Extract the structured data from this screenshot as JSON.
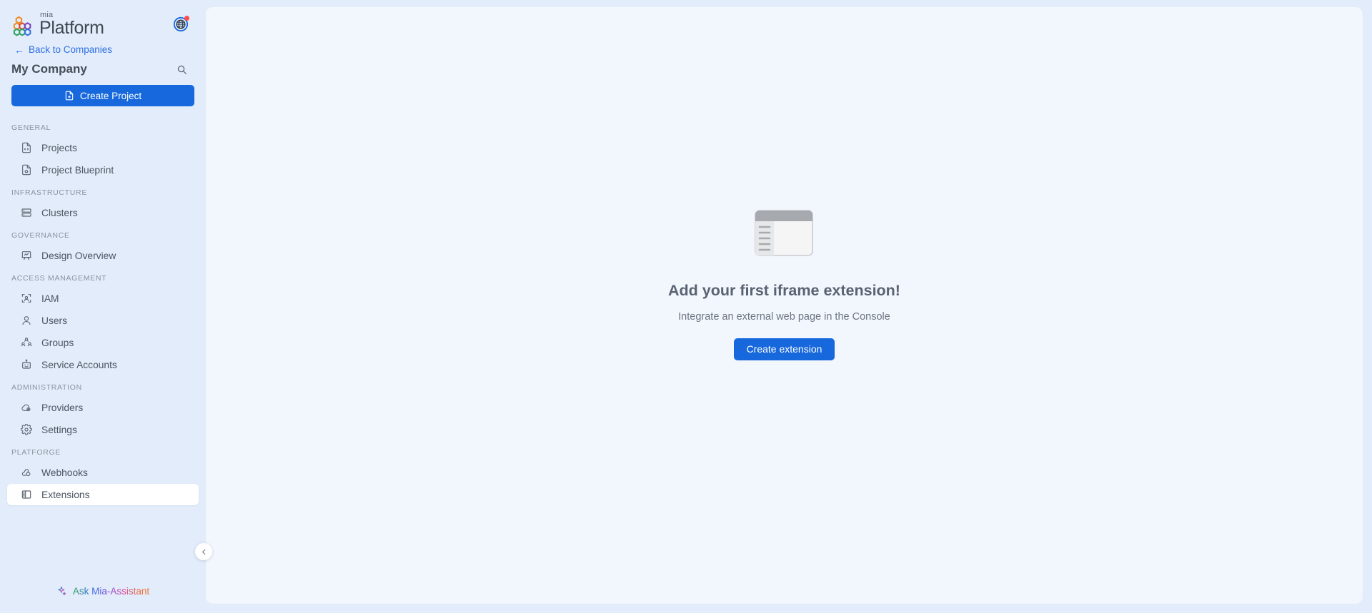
{
  "brand": {
    "superscript": "mia",
    "name": "Platform",
    "logo_icon": "mia-hexagons-logo",
    "globe_icon": "globe-icon",
    "globe_has_notification": true,
    "colors": {
      "hex_orange": "#f08a24",
      "hex_purple": "#7b3fb5",
      "hex_green": "#2aa05a",
      "hex_blue": "#2f6fe4",
      "notification_dot": "#ff4d4f"
    }
  },
  "sidebar": {
    "back_link": {
      "label": "Back to Companies",
      "icon": "arrow-left-icon"
    },
    "company": {
      "name": "My Company",
      "search_icon": "search-icon"
    },
    "create_project": {
      "label": "Create Project",
      "icon": "file-add-icon",
      "color": "#1668dc"
    },
    "groups": [
      {
        "label": "GENERAL",
        "items": [
          {
            "label": "Projects",
            "icon": "file-code-icon",
            "active": false
          },
          {
            "label": "Project Blueprint",
            "icon": "blueprint-icon",
            "active": false
          }
        ]
      },
      {
        "label": "INFRASTRUCTURE",
        "items": [
          {
            "label": "Clusters",
            "icon": "server-icon",
            "active": false
          }
        ]
      },
      {
        "label": "GOVERNANCE",
        "items": [
          {
            "label": "Design Overview",
            "icon": "presentation-icon",
            "active": false
          }
        ]
      },
      {
        "label": "ACCESS MANAGEMENT",
        "items": [
          {
            "label": "IAM",
            "icon": "id-scan-icon",
            "active": false
          },
          {
            "label": "Users",
            "icon": "user-icon",
            "active": false
          },
          {
            "label": "Groups",
            "icon": "group-people-icon",
            "active": false
          },
          {
            "label": "Service Accounts",
            "icon": "robot-icon",
            "active": false
          }
        ]
      },
      {
        "label": "ADMINISTRATION",
        "items": [
          {
            "label": "Providers",
            "icon": "cloud-gear-icon",
            "active": false
          },
          {
            "label": "Settings",
            "icon": "gear-icon",
            "active": false
          }
        ]
      },
      {
        "label": "PLATFORGE",
        "items": [
          {
            "label": "Webhooks",
            "icon": "webhook-icon",
            "active": false
          },
          {
            "label": "Extensions",
            "icon": "layout-panel-icon",
            "active": true
          }
        ]
      }
    ],
    "assistant": {
      "label": "Ask Mia-Assistant",
      "icon": "sparkle-icon"
    },
    "collapse_button": {
      "icon": "chevron-left-icon"
    }
  },
  "main": {
    "empty_state": {
      "illustration_icon": "iframe-window-illustration",
      "title": "Add your first iframe extension!",
      "subtitle": "Integrate an external web page in the Console",
      "cta_label": "Create extension",
      "cta_color": "#1668dc"
    }
  }
}
